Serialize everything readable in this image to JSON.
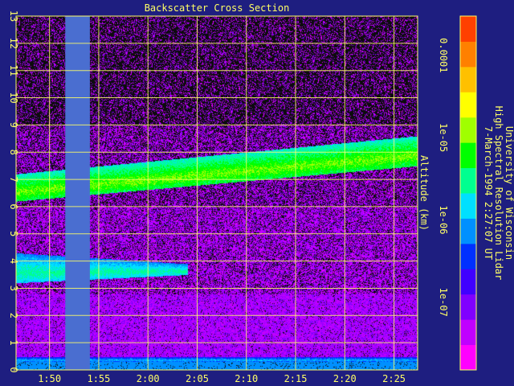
{
  "chart_data": {
    "type": "heatmap",
    "title": "Backscatter Cross Section",
    "ylabel": "Altitude (km)",
    "xlabel": "",
    "x_tick_labels": [
      "1:50",
      "1:55",
      "2:00",
      "2:05",
      "2:10",
      "2:15",
      "2:20",
      "2:25"
    ],
    "x_tick_minutes": [
      110,
      115,
      120,
      125,
      130,
      135,
      140,
      145
    ],
    "xlim_minutes": [
      106.6,
      147.4
    ],
    "y_ticks": [
      0,
      1,
      2,
      3,
      4,
      5,
      6,
      7,
      8,
      9,
      10,
      11,
      12,
      13
    ],
    "ylim": [
      0,
      13
    ],
    "grid": true,
    "colorbar": {
      "scale": "log",
      "range": [
        1.5e-08,
        0.0003
      ],
      "tick_labels": [
        "0.0001",
        "1e-05",
        "1e-06",
        "1e-07"
      ],
      "tick_values": [
        0.0001,
        1e-05,
        1e-06,
        1e-07
      ],
      "colors": [
        "#ff00ff",
        "#c000ff",
        "#8000ff",
        "#4000ff",
        "#0030ff",
        "#0090ff",
        "#00e0ff",
        "#00ff90",
        "#00ff00",
        "#a0ff00",
        "#ffff00",
        "#ffc000",
        "#ff8000",
        "#ff4000"
      ]
    },
    "data_gap_minutes": [
      111.6,
      114.1
    ],
    "layers": [
      {
        "feature": "cloud",
        "time_minutes": [
          106.6,
          147.4
        ],
        "base_km": [
          6.2,
          7.5
        ],
        "top_km": [
          7.2,
          8.6
        ],
        "level": "1e-05"
      },
      {
        "feature": "aerosol",
        "time_minutes": [
          106.6,
          124.0
        ],
        "base_km": [
          3.2,
          3.5
        ],
        "top_km": [
          4.3,
          3.9
        ],
        "level": "3e-06"
      },
      {
        "feature": "boundary-layer",
        "time_minutes": [
          106.6,
          147.4
        ],
        "base_km": [
          0.3,
          0.3
        ],
        "top_km": [
          0.5,
          0.5
        ],
        "level": "1e-06"
      }
    ],
    "side_text": [
      "University of Wisconsin",
      "High Spectral Resolution Lidar",
      "7-March-1994  2:27:07 UT"
    ]
  }
}
